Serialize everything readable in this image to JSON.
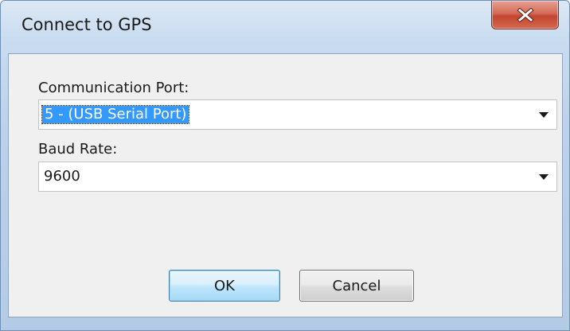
{
  "window": {
    "title": "Connect to GPS",
    "close_icon": "close-icon"
  },
  "form": {
    "port_label": "Communication Port:",
    "port_value": "5 - (USB Serial Port)",
    "baud_label": "Baud Rate:",
    "baud_value": "9600"
  },
  "buttons": {
    "ok_label": "OK",
    "cancel_label": "Cancel"
  },
  "colors": {
    "selection": "#3399ff",
    "close_button": "#c24530"
  }
}
